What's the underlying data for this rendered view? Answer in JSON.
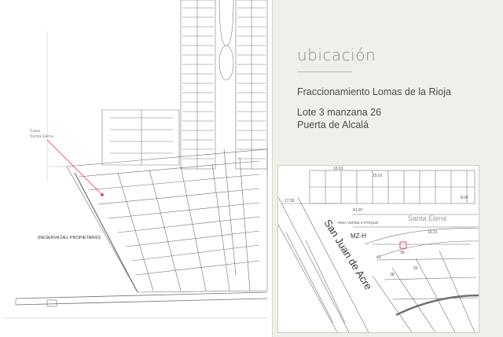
{
  "heading": "ubicación",
  "subdivision": "Fraccionamiento Lomas de la Rioja",
  "lot": "Lote 3 manzana 26",
  "street": "Puerta de Alcalá",
  "site_map": {
    "casa_label_1": "Casa",
    "casa_label_2": "Santa Elena",
    "reserve_label": "(RESERVA DEL PROPIETARIO)"
  },
  "detail_map": {
    "street_main": "San Juan de Acre",
    "street_secondary": "Santa Elena",
    "block_label": "MZ-H",
    "green_area": "AREA VERDE 6   PARQUE",
    "lot_numbers": [
      "40",
      "38",
      "39",
      "20",
      "8.00",
      "10.01",
      "15.01",
      "10.21",
      "17.50",
      "41.87"
    ]
  },
  "colors": {
    "background": "#f1efea",
    "map_line": "#6f6f6f",
    "highlight": "#d9234b"
  }
}
